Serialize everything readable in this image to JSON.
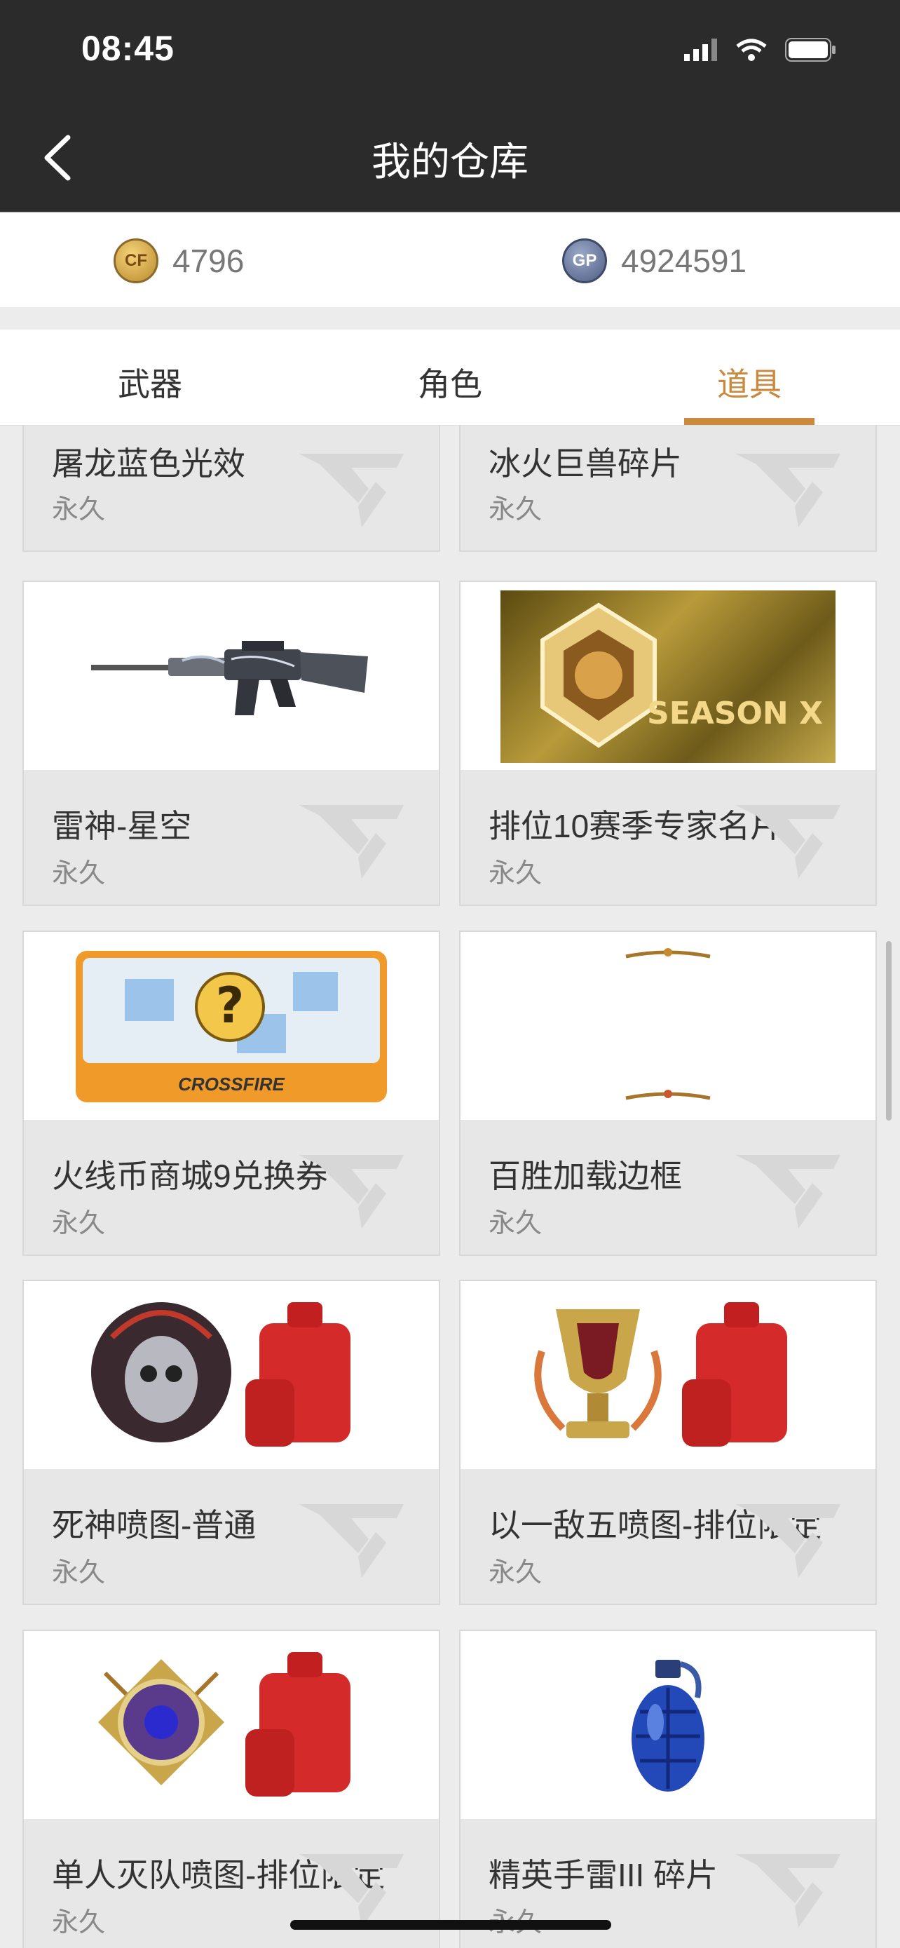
{
  "status": {
    "time": "08:45"
  },
  "header": {
    "title": "我的仓库"
  },
  "currency": {
    "cf_points": "4796",
    "cf_label": "CF",
    "gp_points": "4924591",
    "gp_label": "GP"
  },
  "tabs": [
    {
      "label": "武器",
      "active": false
    },
    {
      "label": "角色",
      "active": false
    },
    {
      "label": "道具",
      "active": true
    }
  ],
  "items": [
    {
      "name": "屠龙蓝色光效",
      "duration": "永久",
      "image": "none"
    },
    {
      "name": "冰火巨兽碎片",
      "duration": "永久",
      "image": "none"
    },
    {
      "name": "雷神-星空",
      "duration": "永久",
      "image": "rifle-icon"
    },
    {
      "name": "排位10赛季专家名片",
      "duration": "永久",
      "image": "season-card-icon",
      "image_text": "SEASON X"
    },
    {
      "name": "火线币商城9兑换券",
      "duration": "永久",
      "image": "voucher-icon",
      "image_text": "CROSSFIRE"
    },
    {
      "name": "百胜加载边框",
      "duration": "永久",
      "image": "frame-icon"
    },
    {
      "name": "死神喷图-普通",
      "duration": "永久",
      "image": "spray-reaper-icon"
    },
    {
      "name": "以一敌五喷图-排位限定",
      "duration": "永久",
      "image": "spray-trophy-icon"
    },
    {
      "name": "单人灭队喷图-排位限定",
      "duration": "永久",
      "image": "spray-emblem-icon"
    },
    {
      "name": "精英手雷III 碎片",
      "duration": "永久",
      "image": "grenade-icon"
    }
  ],
  "colors": {
    "accent": "#c98a3d",
    "header_bg": "#2b2b2b",
    "card_info_bg": "#e7e7e7",
    "page_bg": "#ececec"
  }
}
